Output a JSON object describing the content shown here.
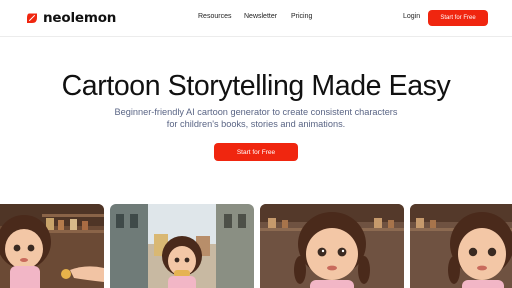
{
  "brand": {
    "name": "neolemon",
    "color": "#f0260f"
  },
  "nav": {
    "links": [
      "Resources",
      "Newsletter",
      "Pricing"
    ],
    "login": "Login",
    "cta": "Start for Free"
  },
  "hero": {
    "title": "Cartoon Storytelling Made Easy",
    "subtitle_line1": "Beginner-friendly AI cartoon generator to create consistent characters",
    "subtitle_line2": "for children's books, stories and animations.",
    "cta": "Start for Free"
  },
  "gallery": {
    "items": [
      {
        "icon": "cartoon-girl-shop-image"
      },
      {
        "icon": "cartoon-girl-street-image"
      },
      {
        "icon": "cartoon-girl-portrait-image"
      },
      {
        "icon": "cartoon-girl-portrait-image"
      }
    ]
  }
}
